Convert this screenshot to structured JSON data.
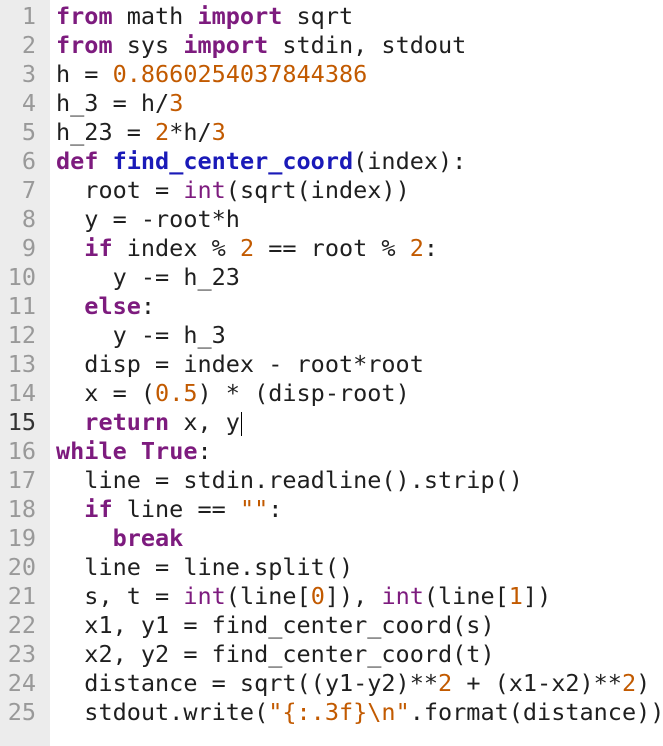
{
  "editor": {
    "cursor_line": 15,
    "lines": [
      {
        "n": "1",
        "tokens": [
          {
            "t": "from",
            "k": "kw"
          },
          {
            "t": " math ",
            "k": "plain"
          },
          {
            "t": "import",
            "k": "kw"
          },
          {
            "t": " sqrt",
            "k": "plain"
          }
        ]
      },
      {
        "n": "2",
        "tokens": [
          {
            "t": "from",
            "k": "kw"
          },
          {
            "t": " sys ",
            "k": "plain"
          },
          {
            "t": "import",
            "k": "kw"
          },
          {
            "t": " stdin, stdout",
            "k": "plain"
          }
        ]
      },
      {
        "n": "3",
        "tokens": [
          {
            "t": "h = ",
            "k": "plain"
          },
          {
            "t": "0.8660254037844386",
            "k": "num"
          }
        ]
      },
      {
        "n": "4",
        "tokens": [
          {
            "t": "h_3 = h/",
            "k": "plain"
          },
          {
            "t": "3",
            "k": "num"
          }
        ]
      },
      {
        "n": "5",
        "tokens": [
          {
            "t": "h_23 = ",
            "k": "plain"
          },
          {
            "t": "2",
            "k": "num"
          },
          {
            "t": "*h/",
            "k": "plain"
          },
          {
            "t": "3",
            "k": "num"
          }
        ]
      },
      {
        "n": "6",
        "tokens": [
          {
            "t": "def",
            "k": "kw"
          },
          {
            "t": " ",
            "k": "plain"
          },
          {
            "t": "find_center_coord",
            "k": "def"
          },
          {
            "t": "(index):",
            "k": "plain"
          }
        ]
      },
      {
        "n": "7",
        "tokens": [
          {
            "t": "  root = ",
            "k": "plain"
          },
          {
            "t": "int",
            "k": "bi"
          },
          {
            "t": "(sqrt(index))",
            "k": "plain"
          }
        ]
      },
      {
        "n": "8",
        "tokens": [
          {
            "t": "  y = -root*h",
            "k": "plain"
          }
        ]
      },
      {
        "n": "9",
        "tokens": [
          {
            "t": "  ",
            "k": "plain"
          },
          {
            "t": "if",
            "k": "kw"
          },
          {
            "t": " index % ",
            "k": "plain"
          },
          {
            "t": "2",
            "k": "num"
          },
          {
            "t": " == root % ",
            "k": "plain"
          },
          {
            "t": "2",
            "k": "num"
          },
          {
            "t": ":",
            "k": "plain"
          }
        ]
      },
      {
        "n": "10",
        "tokens": [
          {
            "t": "    y -= h_23",
            "k": "plain"
          }
        ]
      },
      {
        "n": "11",
        "tokens": [
          {
            "t": "  ",
            "k": "plain"
          },
          {
            "t": "else",
            "k": "kw"
          },
          {
            "t": ":",
            "k": "plain"
          }
        ]
      },
      {
        "n": "12",
        "tokens": [
          {
            "t": "    y -= h_3",
            "k": "plain"
          }
        ]
      },
      {
        "n": "13",
        "tokens": [
          {
            "t": "  disp = index - root*root",
            "k": "plain"
          }
        ]
      },
      {
        "n": "14",
        "tokens": [
          {
            "t": "  x = (",
            "k": "plain"
          },
          {
            "t": "0.5",
            "k": "num"
          },
          {
            "t": ") * (disp-root)",
            "k": "plain"
          }
        ]
      },
      {
        "n": "15",
        "tokens": [
          {
            "t": "  ",
            "k": "plain"
          },
          {
            "t": "return",
            "k": "kw"
          },
          {
            "t": " x, y",
            "k": "plain"
          }
        ]
      },
      {
        "n": "16",
        "tokens": [
          {
            "t": "while",
            "k": "kw"
          },
          {
            "t": " ",
            "k": "plain"
          },
          {
            "t": "True",
            "k": "kw"
          },
          {
            "t": ":",
            "k": "plain"
          }
        ]
      },
      {
        "n": "17",
        "tokens": [
          {
            "t": "  line = stdin.readline().strip()",
            "k": "plain"
          }
        ]
      },
      {
        "n": "18",
        "tokens": [
          {
            "t": "  ",
            "k": "plain"
          },
          {
            "t": "if",
            "k": "kw"
          },
          {
            "t": " line == ",
            "k": "plain"
          },
          {
            "t": "\"\"",
            "k": "str"
          },
          {
            "t": ":",
            "k": "plain"
          }
        ]
      },
      {
        "n": "19",
        "tokens": [
          {
            "t": "    ",
            "k": "plain"
          },
          {
            "t": "break",
            "k": "kw"
          }
        ]
      },
      {
        "n": "20",
        "tokens": [
          {
            "t": "  line = line.split()",
            "k": "plain"
          }
        ]
      },
      {
        "n": "21",
        "tokens": [
          {
            "t": "  s, t = ",
            "k": "plain"
          },
          {
            "t": "int",
            "k": "bi"
          },
          {
            "t": "(line[",
            "k": "plain"
          },
          {
            "t": "0",
            "k": "num"
          },
          {
            "t": "]), ",
            "k": "plain"
          },
          {
            "t": "int",
            "k": "bi"
          },
          {
            "t": "(line[",
            "k": "plain"
          },
          {
            "t": "1",
            "k": "num"
          },
          {
            "t": "])",
            "k": "plain"
          }
        ]
      },
      {
        "n": "22",
        "tokens": [
          {
            "t": "  x1, y1 = find_center_coord(s)",
            "k": "plain"
          }
        ]
      },
      {
        "n": "23",
        "tokens": [
          {
            "t": "  x2, y2 = find_center_coord(t)",
            "k": "plain"
          }
        ]
      },
      {
        "n": "24",
        "tokens": [
          {
            "t": "  distance = sqrt((y1-y2)**",
            "k": "plain"
          },
          {
            "t": "2",
            "k": "num"
          },
          {
            "t": " + (x1-x2)**",
            "k": "plain"
          },
          {
            "t": "2",
            "k": "num"
          },
          {
            "t": ")",
            "k": "plain"
          }
        ]
      },
      {
        "n": "25",
        "tokens": [
          {
            "t": "  stdout.write(",
            "k": "plain"
          },
          {
            "t": "\"{:.3f}\\n\"",
            "k": "str"
          },
          {
            "t": ".format(distance))",
            "k": "plain"
          }
        ]
      }
    ]
  }
}
